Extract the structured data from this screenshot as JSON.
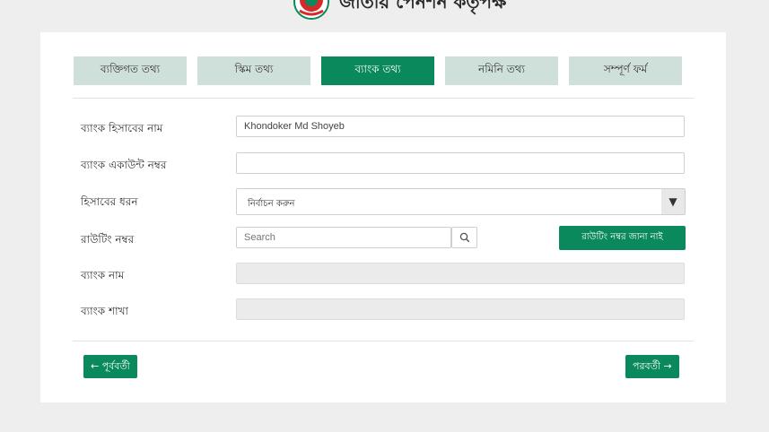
{
  "header": {
    "title": "জাতীয় পেনশন কর্তৃপক্ষ"
  },
  "tabs": [
    {
      "label": "ব্যক্তিগত তথ্য",
      "active": false
    },
    {
      "label": "স্কিম তথ্য",
      "active": false
    },
    {
      "label": "ব্যাংক তথ্য",
      "active": true
    },
    {
      "label": "নমিনি তথ্য",
      "active": false
    },
    {
      "label": "সম্পূর্ণ ফর্ম",
      "active": false
    }
  ],
  "form": {
    "account_name": {
      "label": "ব্যাংক হিসাবের নাম",
      "value": "Khondoker Md Shoyeb"
    },
    "account_number": {
      "label": "ব্যাংক একাউন্ট নম্বর",
      "value": ""
    },
    "account_type": {
      "label": "হিসাবের ধরন",
      "selected": "নির্বাচন করুন"
    },
    "routing_number": {
      "label": "রাউটিং নম্বর",
      "placeholder": "Search",
      "unknown_button": "রাউটিং নম্বর জানা নাই"
    },
    "bank_name": {
      "label": "ব্যাংক নাম",
      "value": ""
    },
    "bank_branch": {
      "label": "ব্যাংক শাখা",
      "value": ""
    }
  },
  "nav": {
    "prev_label": "← পূর্ববর্তী",
    "next_label": "পরবর্তী →"
  },
  "colors": {
    "primary": "#0a8a5c",
    "tab_inactive": "#cfe0db",
    "page_bg": "#eeeeee",
    "emblem_red": "#d42a2a",
    "emblem_green": "#0a8a5c"
  },
  "icons": {
    "search": "search-icon",
    "select_arrow": "caret-down-icon",
    "emblem": "government-emblem-icon"
  }
}
